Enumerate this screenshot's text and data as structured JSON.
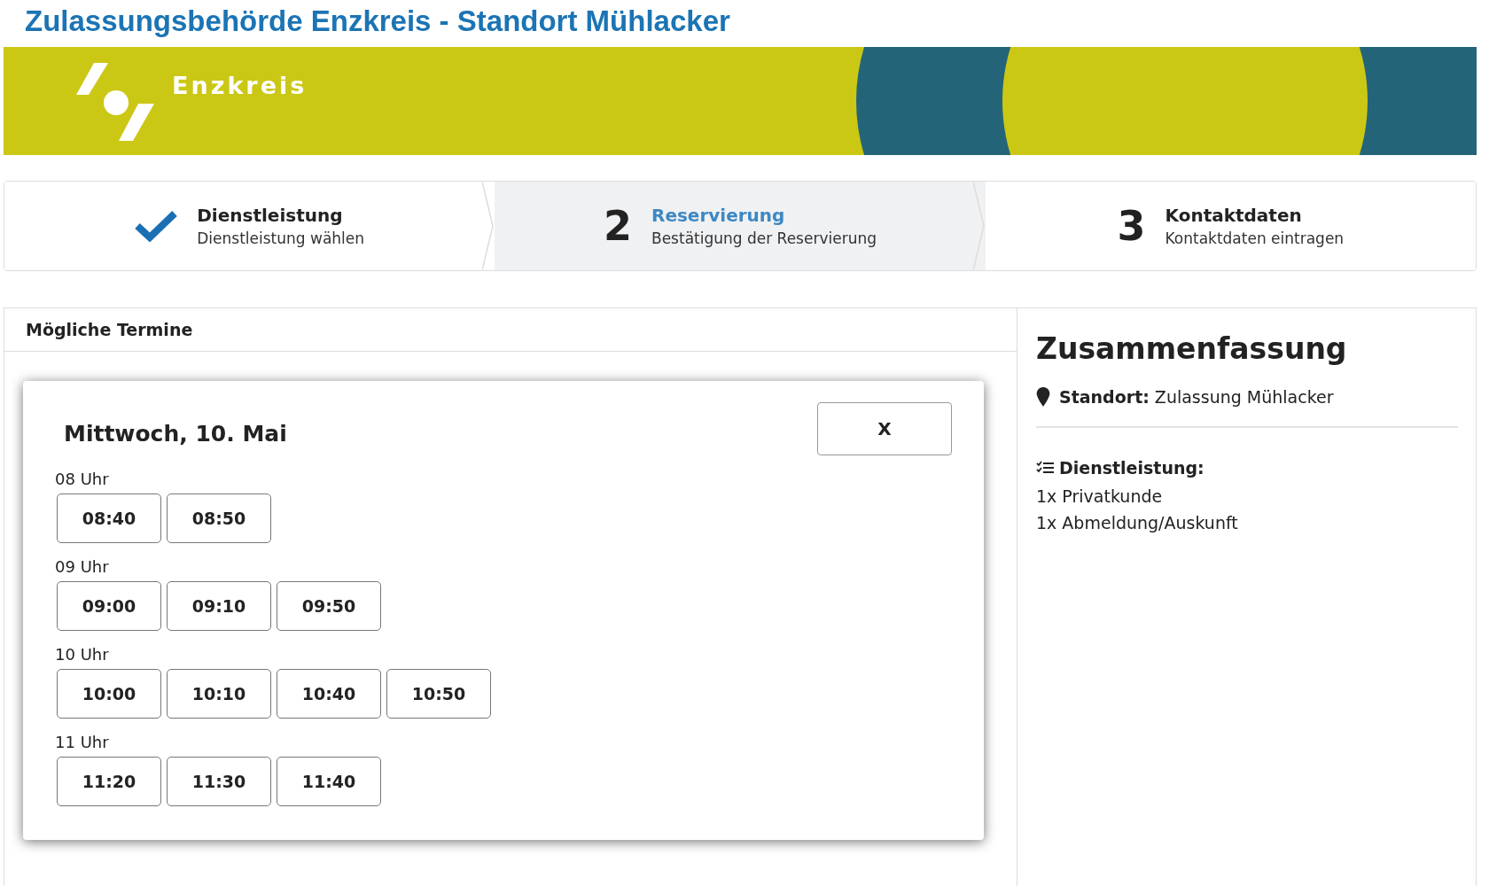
{
  "page_title": "Zulassungsbehörde Enzkreis - Standort Mühlacker",
  "banner": {
    "logo_text": "Enzkreis"
  },
  "steps": [
    {
      "title": "Dienstleistung",
      "subtitle": "Dienstleistung wählen",
      "done": true,
      "selected": false
    },
    {
      "number": "2",
      "title": "Reservierung",
      "subtitle": "Bestätigung der Reservierung",
      "done": false,
      "selected": true
    },
    {
      "number": "3",
      "title": "Kontaktdaten",
      "subtitle": "Kontaktdaten eintragen",
      "done": false,
      "selected": false
    }
  ],
  "appointments": {
    "heading": "Mögliche Termine",
    "dialog": {
      "date": "Mittwoch, 10. Mai",
      "close": "X",
      "groups": [
        {
          "hour": "08 Uhr",
          "slots": [
            "08:40",
            "08:50"
          ]
        },
        {
          "hour": "09 Uhr",
          "slots": [
            "09:00",
            "09:10",
            "09:50"
          ]
        },
        {
          "hour": "10 Uhr",
          "slots": [
            "10:00",
            "10:10",
            "10:40",
            "10:50"
          ]
        },
        {
          "hour": "11 Uhr",
          "slots": [
            "11:20",
            "11:30",
            "11:40"
          ]
        }
      ]
    }
  },
  "summary": {
    "title": "Zusammenfassung",
    "location": "**Standort:** Zulassung Mühlacker",
    "services_label": "Dienstleistung:",
    "services": [
      "1x Privatkunde",
      "1x Abmeldung/Auskunft"
    ]
  }
}
